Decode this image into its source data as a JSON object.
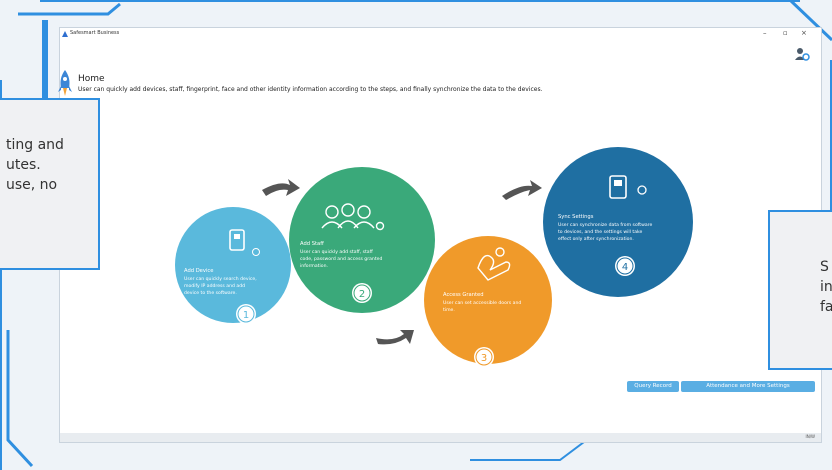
{
  "window": {
    "app_title": "Safesmart Business",
    "controls": [
      "–",
      "▫",
      "×"
    ]
  },
  "home": {
    "title": "Home",
    "description": "User can quickly add devices, staff, fingerprint, face and other identity information according to the steps, and finally synchronize the data to the devices."
  },
  "steps": [
    {
      "number": "1",
      "title": "Add Device",
      "text": "User can quickly search device, modify IP address and add device to the software.",
      "color": "#5ab9dc"
    },
    {
      "number": "2",
      "title": "Add Staff",
      "text": "User can quickly add staff, staff code, password and access granted information.",
      "color": "#3aa97a"
    },
    {
      "number": "3",
      "title": "Access Granted",
      "text": "User can set accessible doors and time.",
      "color": "#f09a2a"
    },
    {
      "number": "4",
      "title": "Sync Settings",
      "text": "User can synchronize data from software to devices, and the settings will take effect only after synchronization.",
      "color": "#1f6fa2"
    }
  ],
  "buttons": {
    "query_record": "Query Record",
    "attendance_settings": "Attendance and More Settings"
  },
  "status": {
    "text": "IN/W"
  },
  "overlays": {
    "left_lines": [
      "ting and",
      "utes.",
      "use, no"
    ],
    "right_lines": [
      "S",
      "in",
      "fa"
    ]
  },
  "colors": {
    "accent": "#2f8fe0",
    "button": "#5aaee3"
  }
}
